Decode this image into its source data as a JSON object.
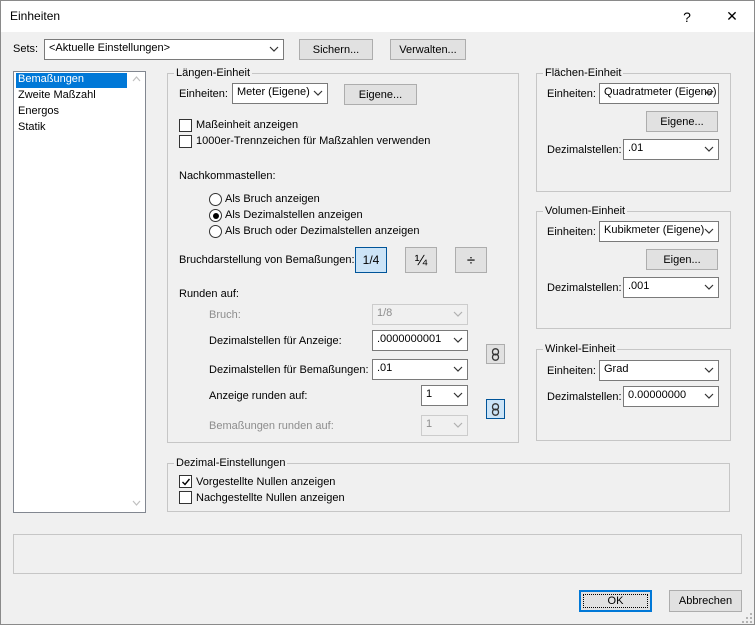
{
  "window": {
    "title": "Einheiten",
    "help_label": "?",
    "close_label": "✕"
  },
  "sets": {
    "label": "Sets:",
    "value": "<Aktuelle Einstellungen>",
    "save_label": "Sichern...",
    "manage_label": "Verwalten..."
  },
  "categories": {
    "items": [
      {
        "label": "Bemaßungen",
        "selected": true
      },
      {
        "label": "Zweite Maßzahl",
        "selected": false
      },
      {
        "label": "Energos",
        "selected": false
      },
      {
        "label": "Statik",
        "selected": false
      }
    ]
  },
  "length": {
    "group_label": "Längen-Einheit",
    "units_label": "Einheiten:",
    "units_value": "Meter (Eigene)",
    "custom_label": "Eigene...",
    "show_unit_label": "Maßeinheit anzeigen",
    "show_unit_checked": false,
    "thousands_label": "1000er-Trennzeichen für Maßzahlen verwenden",
    "thousands_checked": false,
    "decimals_heading": "Nachkommastellen:",
    "radio_fraction": "Als Bruch anzeigen",
    "radio_decimal": "Als Dezimalstellen anzeigen",
    "radio_either": "Als Bruch oder Dezimalstellen anzeigen",
    "radio_selected": "decimal",
    "fraction_display_label": "Bruchdarstellung von Bemaßungen:",
    "fraction_styles": [
      "1/4",
      "¼",
      "÷"
    ],
    "rounding_heading": "Runden auf:",
    "fraction_label": "Bruch:",
    "fraction_value": "1/8",
    "display_decimals_label": "Dezimalstellen für Anzeige:",
    "display_decimals_value": ".0000000001",
    "dim_decimals_label": "Dezimalstellen für Bemaßungen:",
    "dim_decimals_value": ".01",
    "round_display_label": "Anzeige runden auf:",
    "round_display_value": "1",
    "round_dims_label": "Bemaßungen runden auf:",
    "round_dims_value": "1"
  },
  "area": {
    "group_label": "Flächen-Einheit",
    "units_label": "Einheiten:",
    "units_value": "Quadratmeter (Eigene)",
    "custom_label": "Eigene...",
    "decimals_label": "Dezimalstellen:",
    "decimals_value": ".01"
  },
  "volume": {
    "group_label": "Volumen-Einheit",
    "units_label": "Einheiten:",
    "units_value": "Kubikmeter (Eigene)",
    "custom_label": "Eigen...",
    "decimals_label": "Dezimalstellen:",
    "decimals_value": ".001"
  },
  "angle": {
    "group_label": "Winkel-Einheit",
    "units_label": "Einheiten:",
    "units_value": "Grad",
    "decimals_label": "Dezimalstellen:",
    "decimals_value": "0.00000000"
  },
  "decimal": {
    "group_label": "Dezimal-Einstellungen",
    "leading_label": "Vorgestellte Nullen anzeigen",
    "leading_checked": true,
    "trailing_label": "Nachgestellte Nullen anzeigen",
    "trailing_checked": false
  },
  "footer": {
    "ok_label": "OK",
    "cancel_label": "Abbrechen"
  }
}
